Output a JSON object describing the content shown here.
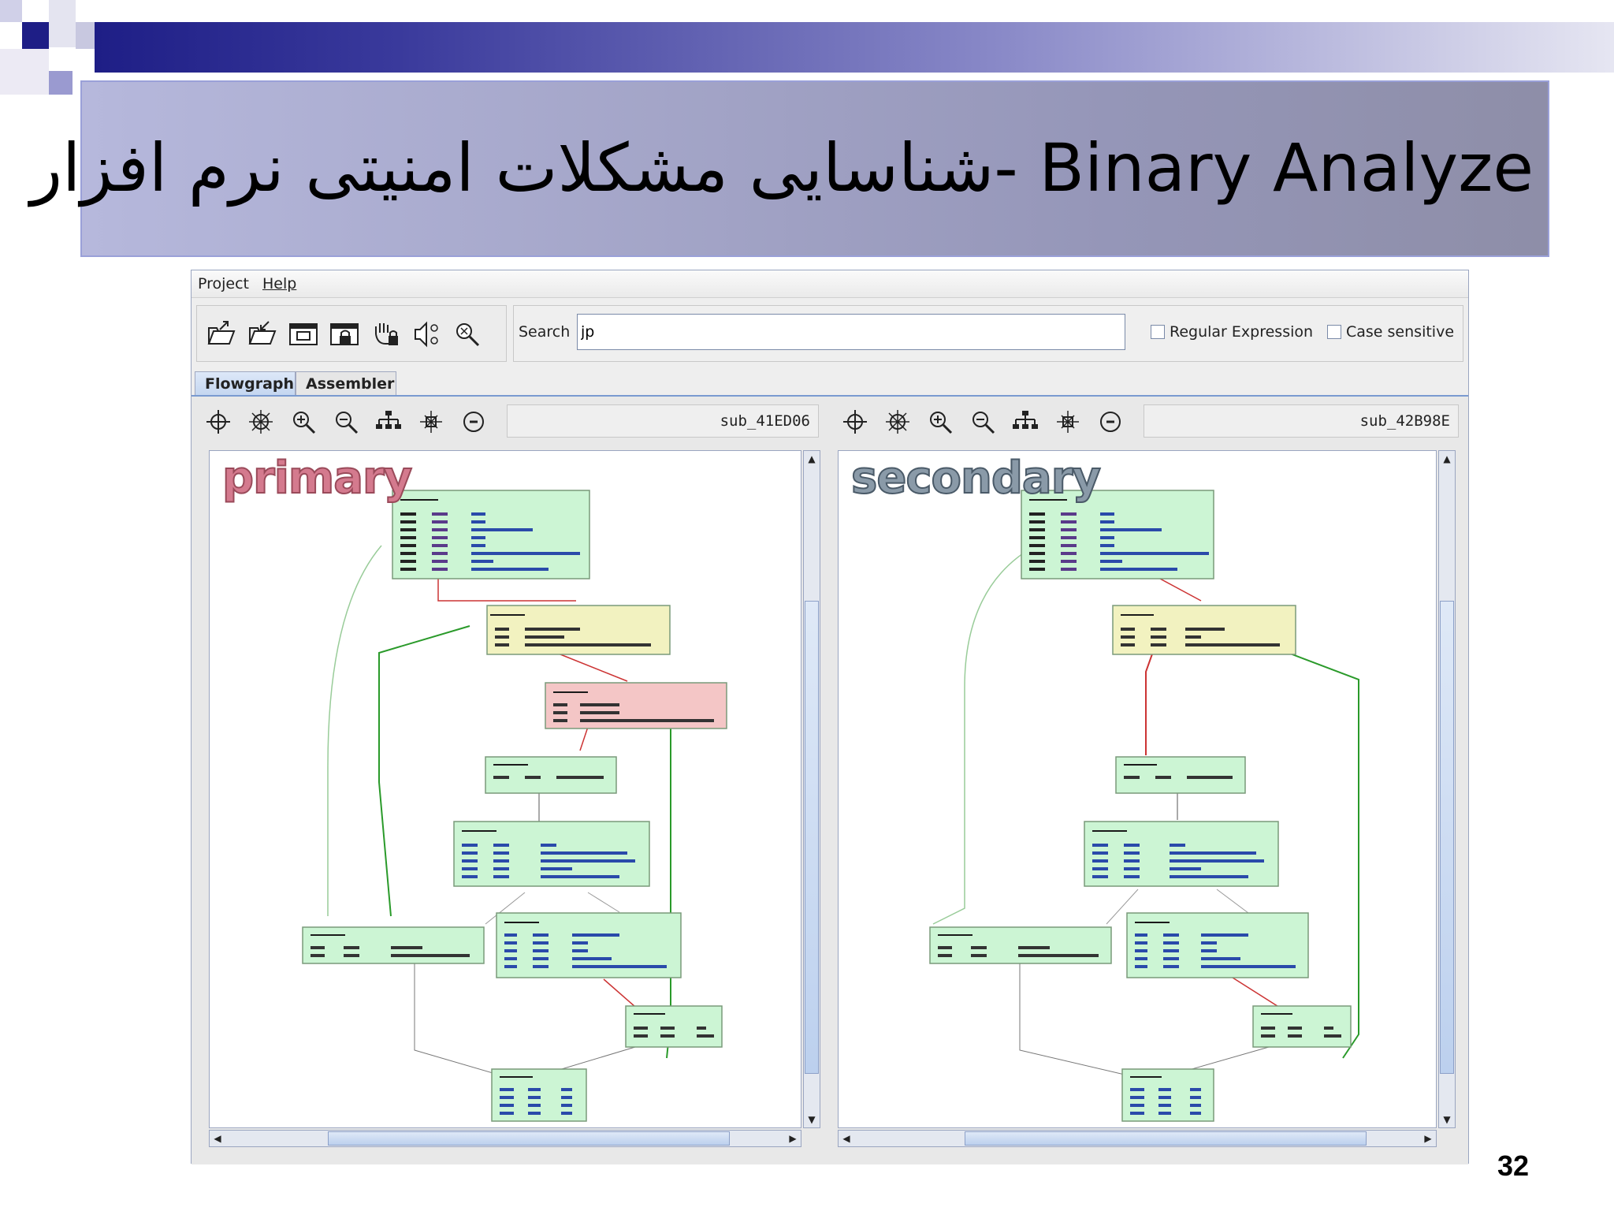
{
  "slide": {
    "title": "شناسایی مشکلات امنیتی نرم افزار- Binary Analyze",
    "page_number": "32",
    "colors": {
      "band_dark": "#1e1e86",
      "band_light": "#b6b8dc"
    }
  },
  "app": {
    "menu": [
      "Project",
      "Help"
    ],
    "toolbar_icons": [
      "open-folder-icon",
      "save-icon",
      "window-icon",
      "lock-window-icon",
      "hand-lock-icon",
      "sound-icon",
      "search-icon"
    ],
    "search": {
      "label": "Search",
      "value": "jp"
    },
    "options": {
      "regex_label": "Regular Expression",
      "case_label": "Case sensitive"
    },
    "tabs": [
      {
        "label": "Flowgraph",
        "active": true
      },
      {
        "label": "Assembler",
        "active": false
      }
    ],
    "graph_tool_icons": [
      "crosshair-icon",
      "expand-icon",
      "zoom-in-icon",
      "zoom-out-icon",
      "hierarchy-icon",
      "fit-icon",
      "circle-minus-icon"
    ],
    "panels": [
      {
        "function_name": "sub_41ED06",
        "watermark": "primary"
      },
      {
        "function_name": "sub_42B98E",
        "watermark": "secondary"
      }
    ]
  }
}
